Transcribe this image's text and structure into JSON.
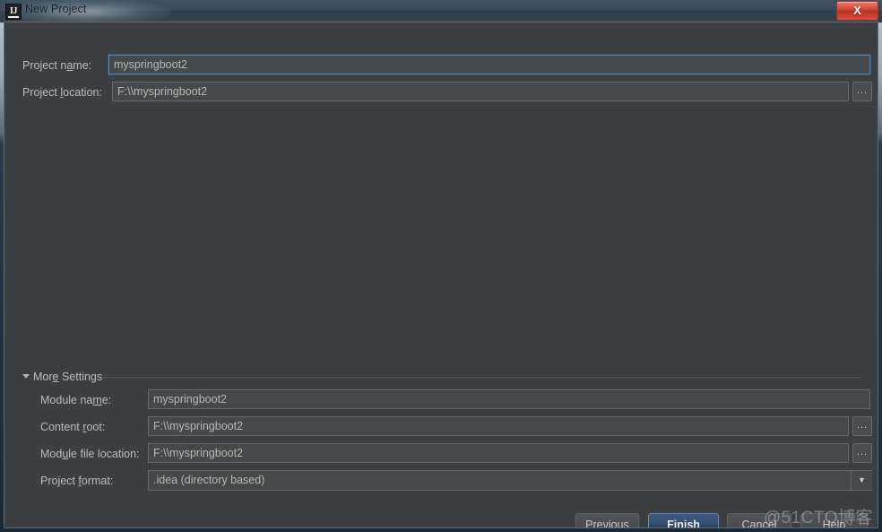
{
  "window": {
    "title": "New Project",
    "app_icon": "intellij-idea-icon",
    "close_label": "X"
  },
  "form": {
    "project_name": {
      "label_pre": "Project n",
      "label_mnemonic": "a",
      "label_post": "me:",
      "value": "myspringboot2",
      "focused": true
    },
    "project_location": {
      "label_pre": "Project ",
      "label_mnemonic": "l",
      "label_post": "ocation:",
      "value": "F:\\\\myspringboot2",
      "browse_label": "..."
    }
  },
  "more_settings": {
    "label_pre": "Mor",
    "label_mnemonic": "e",
    "label_post": " Settings",
    "expanded": true,
    "fields": {
      "module_name": {
        "label_pre": "Module na",
        "label_mnemonic": "m",
        "label_post": "e:",
        "value": "myspringboot2"
      },
      "content_root": {
        "label_pre": "Content ",
        "label_mnemonic": "r",
        "label_post": "oot:",
        "value": "F:\\\\myspringboot2",
        "browse_label": "..."
      },
      "module_file_location": {
        "label_pre": "Mod",
        "label_mnemonic": "u",
        "label_post": "le file location:",
        "value": "F:\\\\myspringboot2",
        "browse_label": "..."
      },
      "project_format": {
        "label_pre": "Project ",
        "label_mnemonic": "f",
        "label_post": "ormat:",
        "value": ".idea (directory based)",
        "arrow": "▼"
      }
    }
  },
  "buttons": {
    "previous": {
      "pre": "",
      "mnemonic": "P",
      "post": "revious"
    },
    "finish": {
      "pre": "",
      "mnemonic": "F",
      "post": "inish"
    },
    "cancel": {
      "pre": "Cancel",
      "mnemonic": "",
      "post": ""
    },
    "help": {
      "pre": "Help",
      "mnemonic": "",
      "post": ""
    }
  },
  "watermark": {
    "text": "@51CTO博客"
  },
  "colors": {
    "dialog_background": "#3c3f41",
    "field_background": "#45494a",
    "field_border": "#646a6c",
    "focus_border": "#4d87c7",
    "text": "#bbbbbb",
    "titlebar": "#39495a",
    "close_red": "#d94d3c",
    "default_button_blue": "#35506f"
  }
}
